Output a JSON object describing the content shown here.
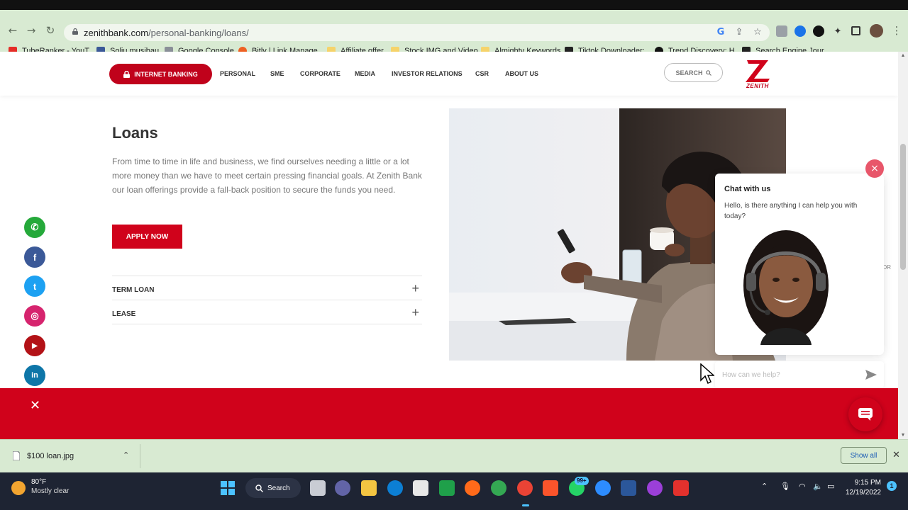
{
  "browser": {
    "url_host": "zenithbank.com",
    "url_path": "/personal-banking/loans/",
    "bookmarks": [
      {
        "label": "TubeRanker - YouT...",
        "color": "#e52d27"
      },
      {
        "label": "Soliu musibau",
        "color": "#3b5998"
      },
      {
        "label": "Google Console",
        "color": "#8a8f98"
      },
      {
        "label": "Bitly | Link Manage...",
        "color": "#ee6123"
      },
      {
        "label": "Affiliate offer",
        "color": "#f5d36b"
      },
      {
        "label": "Stock IMG and Video",
        "color": "#f5d36b"
      },
      {
        "label": "Almighty Keywords",
        "color": "#f5d36b"
      },
      {
        "label": "Tiktok Downloader:...",
        "color": "#222222"
      },
      {
        "label": "Trend Discovery: H...",
        "color": "#111111"
      },
      {
        "label": "Search Engine Jour...",
        "color": "#222222"
      }
    ]
  },
  "header": {
    "internet_banking": "INTERNET BANKING",
    "nav": [
      "PERSONAL",
      "SME",
      "CORPORATE",
      "MEDIA",
      "INVESTOR RELATIONS",
      "CSR",
      "ABOUT US"
    ],
    "search": "SEARCH",
    "logo_text": "ZENITH"
  },
  "main": {
    "title": "Loans",
    "description": "From time to time in life and business, we find ourselves needing a little or a lot more money than we have to meet certain pressing financial goals. At Zenith Bank our loan offerings provide a fall-back position to secure the funds you need.",
    "apply_button": "APPLY NOW",
    "accordion": [
      {
        "label": "TERM LOAN",
        "toggle": "+"
      },
      {
        "label": "LEASE",
        "toggle": "+"
      }
    ]
  },
  "social": [
    {
      "name": "whatsapp",
      "glyph": "✆",
      "color": "#25a93a"
    },
    {
      "name": "facebook",
      "glyph": "f",
      "color": "#3b5998"
    },
    {
      "name": "twitter",
      "glyph": "t",
      "color": "#1da1f2"
    },
    {
      "name": "instagram",
      "glyph": "◎",
      "color": "#d6246e"
    },
    {
      "name": "youtube",
      "glyph": "▶",
      "color": "#b31217"
    },
    {
      "name": "linkedin",
      "glyph": "in",
      "color": "#0e76a8"
    }
  ],
  "chat": {
    "title": "Chat with us",
    "message": "Hello, is there anything I can help you with today?",
    "input_placeholder": "How can we help?",
    "close": "×",
    "side_fragment": "OR"
  },
  "banner": {
    "close": "✕"
  },
  "download_bar": {
    "filename": "$100 loan.jpg",
    "caret": "⌃",
    "show_all": "Show all",
    "close": "✕"
  },
  "taskbar": {
    "temperature": "80°F",
    "weather": "Mostly clear",
    "search": "Search",
    "time": "9:15 PM",
    "date": "12/19/2022",
    "whatsapp_badge": "99+",
    "notification_count": "1"
  },
  "colors": {
    "brand_red": "#d0021b",
    "chrome_green": "#d8ead2",
    "taskbar": "#1e2433"
  }
}
